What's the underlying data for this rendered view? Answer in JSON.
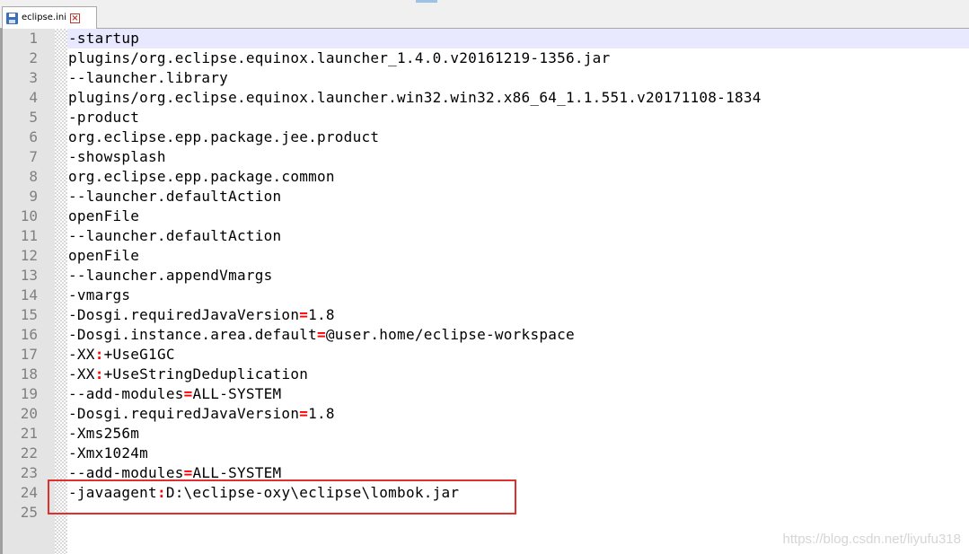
{
  "tab": {
    "label": "eclipse.ini",
    "close_label": "×",
    "icon": "save-icon"
  },
  "lines": [
    {
      "num": "1",
      "text": "-startup",
      "current": true
    },
    {
      "num": "2",
      "text": "plugins/org.eclipse.equinox.launcher_1.4.0.v20161219-1356.jar"
    },
    {
      "num": "3",
      "text": "--launcher.library"
    },
    {
      "num": "4",
      "text": "plugins/org.eclipse.equinox.launcher.win32.win32.x86_64_1.1.551.v20171108-1834"
    },
    {
      "num": "5",
      "text": "-product"
    },
    {
      "num": "6",
      "text": "org.eclipse.epp.package.jee.product"
    },
    {
      "num": "7",
      "text": "-showsplash"
    },
    {
      "num": "8",
      "text": "org.eclipse.epp.package.common"
    },
    {
      "num": "9",
      "text": "--launcher.defaultAction"
    },
    {
      "num": "10",
      "text": "openFile"
    },
    {
      "num": "11",
      "text": "--launcher.defaultAction"
    },
    {
      "num": "12",
      "text": "openFile"
    },
    {
      "num": "13",
      "text": "--launcher.appendVmargs"
    },
    {
      "num": "14",
      "text": "-vmargs"
    },
    {
      "num": "15",
      "text": "-Dosgi.requiredJavaVersion=1.8"
    },
    {
      "num": "16",
      "text": "-Dosgi.instance.area.default=@user.home/eclipse-workspace"
    },
    {
      "num": "17",
      "text": "-XX:+UseG1GC"
    },
    {
      "num": "18",
      "text": "-XX:+UseStringDeduplication"
    },
    {
      "num": "19",
      "text": "--add-modules=ALL-SYSTEM"
    },
    {
      "num": "20",
      "text": "-Dosgi.requiredJavaVersion=1.8"
    },
    {
      "num": "21",
      "text": "-Xms256m"
    },
    {
      "num": "22",
      "text": "-Xmx1024m"
    },
    {
      "num": "23",
      "text": "--add-modules=ALL-SYSTEM"
    },
    {
      "num": "24",
      "text": "-javaagent:D:\\eclipse-oxy\\eclipse\\lombok.jar"
    },
    {
      "num": "25",
      "text": ""
    }
  ],
  "colors": {
    "operator": "#ff0000",
    "current_line": "#e8e8ff",
    "highlight_box": "#e0302e",
    "line_number": "#808080"
  },
  "watermark": "https://blog.csdn.net/liyufu318"
}
